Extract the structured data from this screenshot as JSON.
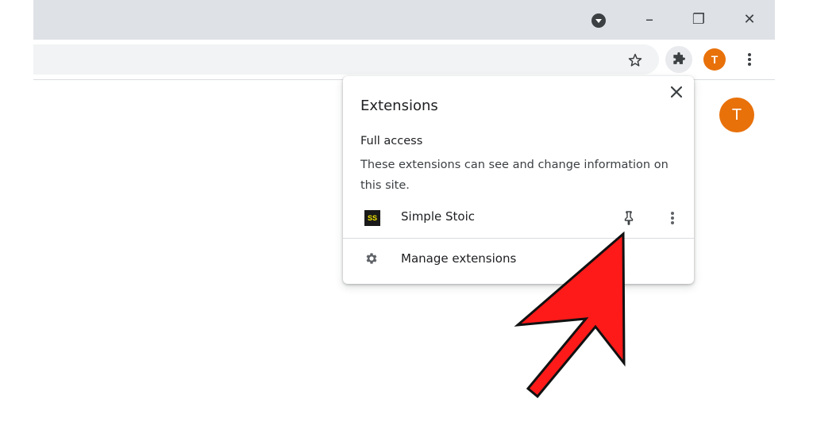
{
  "window_controls": {
    "minimize": "–",
    "restore": "❐",
    "close": "✕"
  },
  "toolbar": {
    "profile_initial": "T"
  },
  "content": {
    "avatar_initial": "T"
  },
  "popup": {
    "title": "Extensions",
    "close": "✕",
    "section_label": "Full access",
    "section_desc": "These extensions can see and change information on this site.",
    "extensions": [
      {
        "logo_text": "SS",
        "name": "Simple Stoic"
      }
    ],
    "manage_label": "Manage extensions"
  },
  "colors": {
    "avatar": "#e8710a",
    "arrow": "#ff0000"
  }
}
